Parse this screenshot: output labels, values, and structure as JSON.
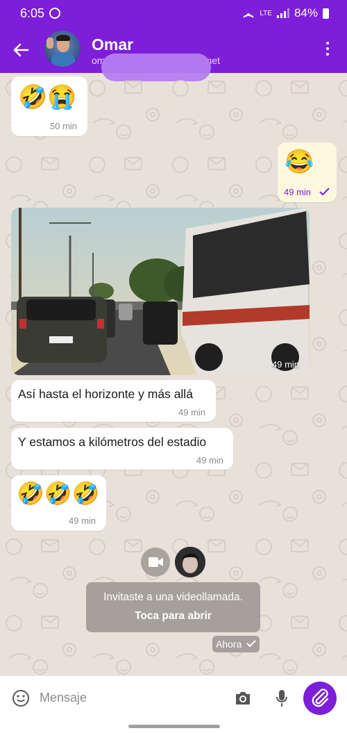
{
  "status_bar": {
    "time": "6:05",
    "network": "LTE",
    "battery": "84%"
  },
  "header": {
    "contact_name": "Omar",
    "contact_sub_prefix": "om",
    "contact_sub_suffix": "net"
  },
  "messages": [
    {
      "direction": "in",
      "emoji": "🤣😭",
      "time": "50 min"
    },
    {
      "direction": "out",
      "emoji": "😂",
      "time": "49 min"
    },
    {
      "direction": "in",
      "type": "photo",
      "time": "49 min"
    },
    {
      "direction": "in",
      "text": "Así hasta el horizonte y más allá",
      "time": "49 min"
    },
    {
      "direction": "in",
      "text": "Y estamos a kilómetros del estadio",
      "time": "49 min"
    },
    {
      "direction": "in",
      "emoji": "🤣🤣🤣",
      "time": "49 min"
    }
  ],
  "video_call": {
    "line1": "Invitaste a una videollamada.",
    "line2": "Toca para abrir",
    "time": "Ahora"
  },
  "input": {
    "placeholder": "Mensaje"
  },
  "colors": {
    "brand": "#7d1ed8",
    "chat_bg": "#e8e1da",
    "outgoing_bubble": "#fdf8de"
  }
}
